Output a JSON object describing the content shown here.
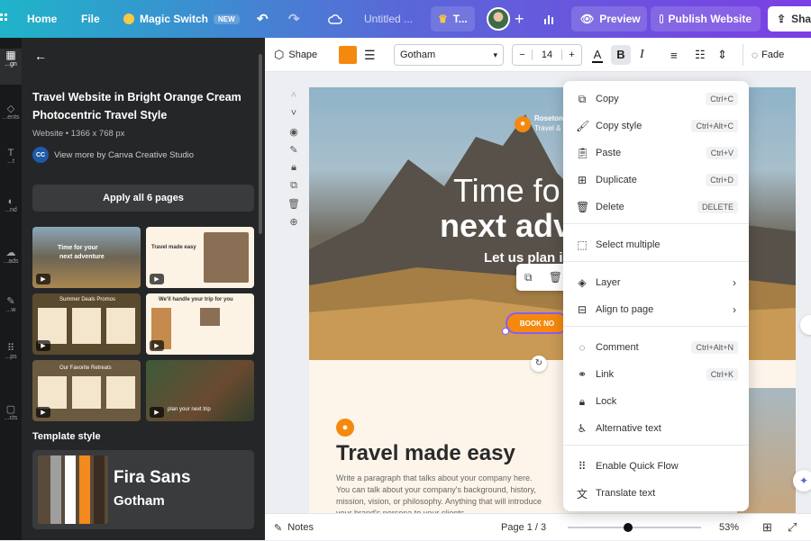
{
  "topbar": {
    "home": "Home",
    "file": "File",
    "magic_switch": "Magic Switch",
    "new_badge": "NEW",
    "doc_title": "Untitled ...",
    "crown_label": "T...",
    "preview": "Preview",
    "publish": "Publish Website",
    "share": "Sha"
  },
  "rail": {
    "items": [
      "...gn",
      "...ents",
      "...t",
      "...nd",
      "...ads",
      "...w",
      "...ps",
      "...cts"
    ]
  },
  "panel": {
    "title": "Travel Website in Bright Orange Cream Photocentric Travel Style",
    "meta": "Website • 1366 x 768 px",
    "author_initials": "CC",
    "author": "View more by Canva Creative Studio",
    "apply_button": "Apply all 6 pages",
    "thumbs": [
      {
        "t1": "Time for your",
        "t2": "next adventure"
      },
      {
        "t1": "Travel made easy",
        "t2": ""
      },
      {
        "t1": "Summer Deals Promos",
        "t2": ""
      },
      {
        "t1": "We'll handle your trip for you",
        "t2": ""
      },
      {
        "t1": "Our Favorite Retreats",
        "t2": ""
      },
      {
        "t1": "plan your next trip",
        "t2": ""
      }
    ],
    "template_style_label": "Template style",
    "font_primary": "Fira Sans",
    "font_secondary": "Gotham",
    "swatch_colors": [
      "#5a4a3a",
      "#9e9e9e",
      "#ffffff",
      "#f28a1e",
      "#3a2c20"
    ]
  },
  "toolbar": {
    "shape": "Shape",
    "fill_color": "#f5890e",
    "font": "Gotham",
    "font_size": "14",
    "minus": "−",
    "plus": "+",
    "bold": "B",
    "italic": "I",
    "fade": "Fade"
  },
  "canvas": {
    "brand_line1": "Roseton",
    "brand_line2": "Travel &",
    "headline1": "Time fo",
    "headline2": "next adv",
    "subhead": "Let us plan i",
    "book_btn": "BOOK NO",
    "section_title": "Travel made easy",
    "body_text": "Write a paragraph that talks about your company here. You can talk about your company's background, history, mission, vision, or philosophy. Anything that will introduce your brand's persona to your clients."
  },
  "context_menu": {
    "items": [
      {
        "icon": "copy-icon",
        "label": "Copy",
        "shortcut": "Ctrl+C"
      },
      {
        "icon": "copy-style-icon",
        "label": "Copy style",
        "shortcut": "Ctrl+Alt+C"
      },
      {
        "icon": "paste-icon",
        "label": "Paste",
        "shortcut": "Ctrl+V"
      },
      {
        "icon": "duplicate-icon",
        "label": "Duplicate",
        "shortcut": "Ctrl+D"
      },
      {
        "icon": "trash-icon",
        "label": "Delete",
        "shortcut": "DELETE"
      },
      {
        "icon": "select-multiple-icon",
        "label": "Select multiple",
        "shortcut": ""
      },
      {
        "icon": "layer-icon",
        "label": "Layer",
        "shortcut": ""
      },
      {
        "icon": "align-icon",
        "label": "Align to page",
        "shortcut": ""
      },
      {
        "icon": "comment-icon",
        "label": "Comment",
        "shortcut": "Ctrl+Alt+N"
      },
      {
        "icon": "link-icon",
        "label": "Link",
        "shortcut": "Ctrl+K"
      },
      {
        "icon": "lock-icon",
        "label": "Lock",
        "shortcut": ""
      },
      {
        "icon": "accessibility-icon",
        "label": "Alternative text",
        "shortcut": ""
      },
      {
        "icon": "quick-flow-icon",
        "label": "Enable Quick Flow",
        "shortcut": ""
      },
      {
        "icon": "translate-icon",
        "label": "Translate text",
        "shortcut": ""
      }
    ]
  },
  "bottombar": {
    "notes": "Notes",
    "page": "Page 1 / 3",
    "zoom": "53%",
    "zoom_fraction": 0.35
  }
}
